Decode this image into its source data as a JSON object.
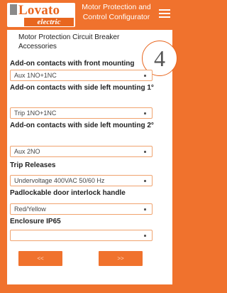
{
  "header": {
    "logo_top": "Lovato",
    "logo_bottom": "electric",
    "app_title": "Motor Protection and Control Configurator",
    "menu_icon": "hamburger-menu-icon"
  },
  "section": {
    "title": "Motor Protection Circuit Breaker Accessories",
    "step_number": "4"
  },
  "fields": [
    {
      "label": "Add-on contacts with front mounting",
      "value": "Aux 1NO+1NC"
    },
    {
      "label": "Add-on contacts with side left mounting 1°",
      "value": "Trip 1NO+1NC"
    },
    {
      "label": "Add-on contacts with side left mounting 2°",
      "value": "Aux 2NO"
    },
    {
      "label": "Trip Releases",
      "value": "Undervoltage 400VAC 50/60 Hz"
    },
    {
      "label": "Padlockable door interlock handle",
      "value": "Red/Yellow"
    },
    {
      "label": "Enclosure IP65",
      "value": ""
    }
  ],
  "navigation": {
    "back_label": "<<",
    "next_label": ">>"
  },
  "colors": {
    "brand_orange": "#f0722d",
    "field_border": "#f0a36f",
    "panel": "#ffffff"
  }
}
